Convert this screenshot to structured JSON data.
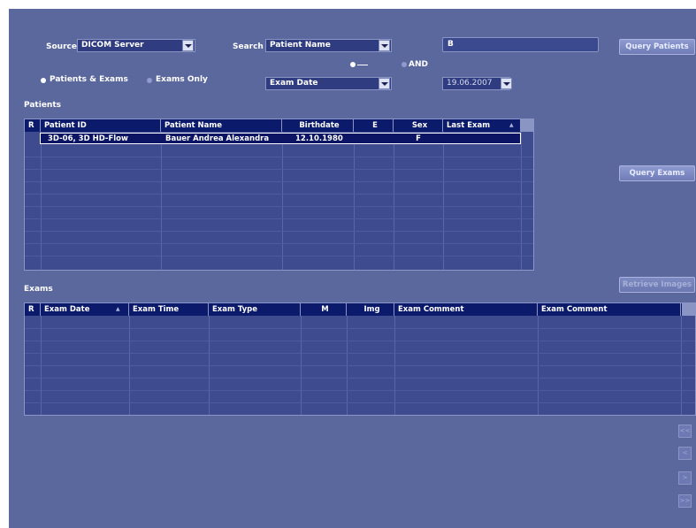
{
  "source": {
    "label": "Source",
    "value": "DICOM Server"
  },
  "search": {
    "label": "Search",
    "field": "Patient Name",
    "value": "B"
  },
  "mode": {
    "selected": "Patients & Exams",
    "other": "Exams Only"
  },
  "logic": {
    "or_label": "",
    "and_label": "AND",
    "selected": "OR"
  },
  "date_filter": {
    "field": "Exam Date",
    "value": "19.06.2007"
  },
  "buttons": {
    "query_patients": "Query Patients",
    "query_exams": "Query Exams",
    "retrieve_images": "Retrieve Images"
  },
  "patients": {
    "title": "Patients",
    "columns": [
      "R",
      "Patient ID",
      "Patient Name",
      "Birthdate",
      "E",
      "Sex",
      "Last Exam"
    ],
    "rows": [
      {
        "id": "3D-06, 3D HD-Flow",
        "name": "Bauer Andrea Alexandra",
        "birthdate": "12.10.1980",
        "e": "",
        "sex": "F",
        "last_exam": ""
      }
    ]
  },
  "exams": {
    "title": "Exams",
    "columns": [
      "R",
      "Exam Date",
      "Exam Time",
      "Exam Type",
      "M",
      "Img",
      "Exam Comment",
      "Exam Comment"
    ]
  },
  "pager": [
    "<<",
    "<",
    ">",
    ">>"
  ],
  "colors": {
    "panel": "#5b689d",
    "header": "#0b1a6a",
    "grid": "#3e4b8f",
    "selected_row": "#0b1563"
  }
}
